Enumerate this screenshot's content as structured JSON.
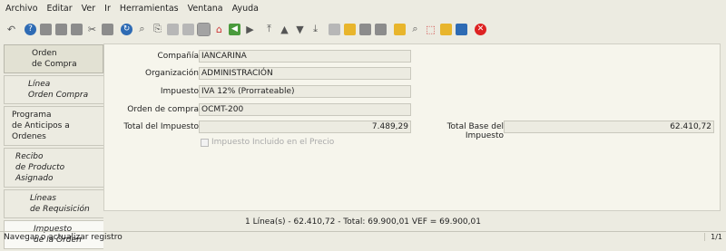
{
  "menu": [
    "Archivo",
    "Editar",
    "Ver",
    "Ir",
    "Herramientas",
    "Ventana",
    "Ayuda"
  ],
  "toolbar_icons": [
    "undo-icon",
    "help-icon",
    "new-icon",
    "copy-icon",
    "delete-icon",
    "delete-selection-icon",
    "save-icon",
    "refresh-icon",
    "find-icon",
    "attachment-icon",
    "chat-icon",
    "history-icon",
    "grid-toggle-icon",
    "home-icon",
    "back-icon",
    "forward-icon",
    "first-record-icon",
    "previous-record-icon",
    "next-record-icon",
    "last-record-icon",
    "report-icon",
    "archive-icon",
    "print-preview-icon",
    "print-icon",
    "lock-icon",
    "zoom-across-icon",
    "active-workflows-icon",
    "requests-icon",
    "product-info-icon",
    "close-window-icon"
  ],
  "tabs": [
    {
      "lines": [
        "Orden",
        "de Compra"
      ]
    },
    {
      "lines": [
        "Línea",
        "Orden Compra"
      ]
    },
    {
      "lines": [
        "Programa",
        "de Anticipos a Ordenes"
      ]
    },
    {
      "lines": [
        "Recibo",
        "de Producto Asignado"
      ]
    },
    {
      "lines": [
        "Líneas",
        "de Requisición"
      ]
    },
    {
      "lines": [
        "Impuesto",
        "de la Orden"
      ]
    }
  ],
  "form": {
    "company_label": "Compañía",
    "company_value": "IANCARINA",
    "org_label": "Organización",
    "org_value": "ADMINISTRACIÓN",
    "tax_label": "Impuesto",
    "tax_value": "IVA 12% (Prorrateable)",
    "order_label": "Orden de compra",
    "order_value": "OCMT-200",
    "tax_total_label": "Total del Impuesto",
    "tax_total_value": "7.489,29",
    "base_total_label": "Total Base del Impuesto",
    "base_total_value": "62.410,72",
    "included_label": "Impuesto Incluido en el Precio"
  },
  "status": {
    "summary": "1 Línea(s) - 62.410,72 -  Total: 69.900,01  VEF =  69.900,01",
    "message": "Navegar o actualizar registro",
    "page": "1/1"
  }
}
